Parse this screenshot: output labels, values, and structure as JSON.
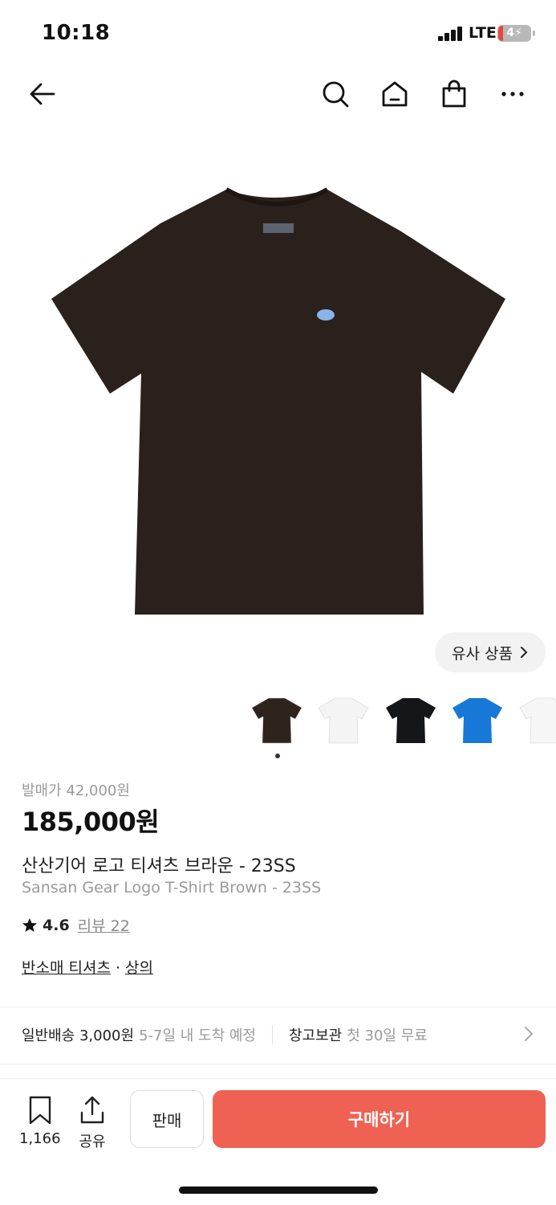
{
  "status_bar": {
    "time": "10:18",
    "network": "LTE",
    "battery": "4"
  },
  "nav": {
    "icons": [
      "back-arrow-icon",
      "search-icon",
      "home-icon",
      "shopping-bag-icon",
      "more-icon"
    ]
  },
  "product_image": {
    "shirt_color": "#2b211c",
    "logo_color": "#8ab4e8"
  },
  "similar_button": {
    "label": "유사 상품"
  },
  "thumbnails": [
    {
      "color": "#2f241d",
      "name": "brown"
    },
    {
      "color": "#f4f4f4",
      "name": "white"
    },
    {
      "color": "#15161a",
      "name": "black"
    },
    {
      "color": "#1878d8",
      "name": "blue"
    },
    {
      "color": "#f6f6f6",
      "name": "white-2"
    }
  ],
  "product": {
    "release_price": "발매가 42,000원",
    "price": "185,000원",
    "name_ko": "산산기어 로고 티셔츠 브라운 - 23SS",
    "name_en": "Sansan Gear Logo T-Shirt Brown - 23SS",
    "rating": "4.6",
    "review_label": "리뷰 22",
    "category_1": "반소매 티셔츠",
    "category_sep": " · ",
    "category_2": "상의"
  },
  "shipping": {
    "main": "일반배송 3,000원",
    "sub": "5-7일 내 도착 예정",
    "storage_main": "창고보관",
    "storage_sub": "첫 30일 무료"
  },
  "bottom_bar": {
    "bookmark_count": "1,166",
    "share_label": "공유",
    "sell_label": "판매",
    "buy_label": "구매하기"
  },
  "colors": {
    "accent": "#ef6253",
    "muted_text": "#9a9a9a"
  }
}
